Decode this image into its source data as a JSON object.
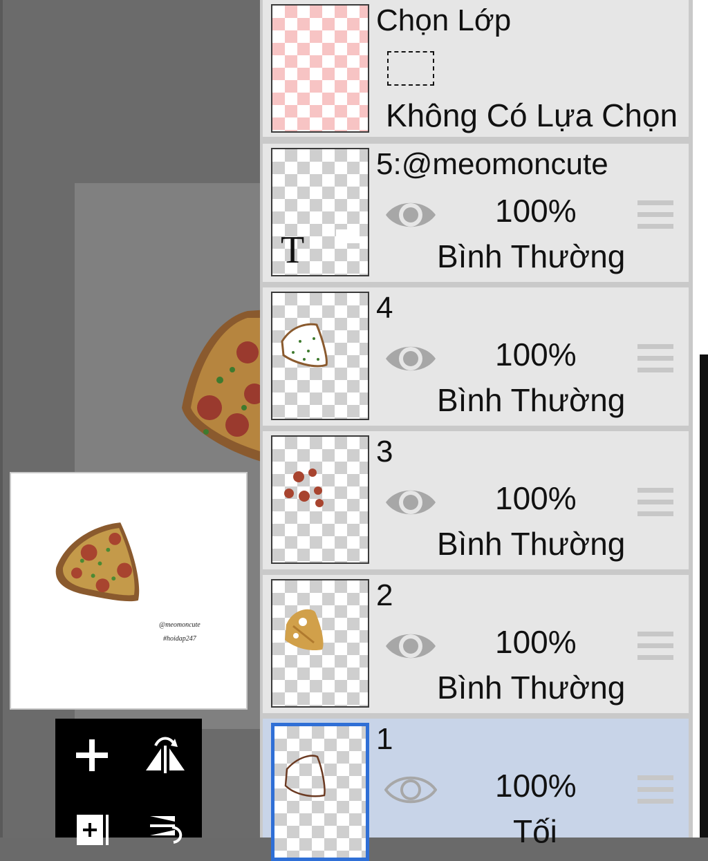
{
  "layer_panel": {
    "selection_row": {
      "title": "Chọn Lớp",
      "status": "Không Có Lựa Chọn"
    },
    "layers": [
      {
        "name": "5:@meomoncute",
        "opacity": "100%",
        "blend": "Bình Thường",
        "visible": true,
        "type": "text",
        "thumb_text": "T",
        "selected": false
      },
      {
        "name": "4",
        "opacity": "100%",
        "blend": "Bình Thường",
        "visible": true,
        "selected": false
      },
      {
        "name": "3",
        "opacity": "100%",
        "blend": "Bình Thường",
        "visible": true,
        "selected": false
      },
      {
        "name": "2",
        "opacity": "100%",
        "blend": "Bình Thường",
        "visible": true,
        "selected": false
      },
      {
        "name": "1",
        "opacity": "100%",
        "blend": "Tối",
        "visible": true,
        "selected": true
      }
    ]
  },
  "preview": {
    "watermark_line1": "@meomoncute",
    "watermark_line2": "#hoidap247"
  },
  "tools": [
    "add-layer-icon",
    "flip-horizontal-icon",
    "add-layer-alt-icon",
    "flip-vertical-icon"
  ],
  "colors": {
    "selected_row": "#c8d4e8",
    "active_border": "#2f6fd6",
    "row_bg": "#e6e6e6"
  }
}
